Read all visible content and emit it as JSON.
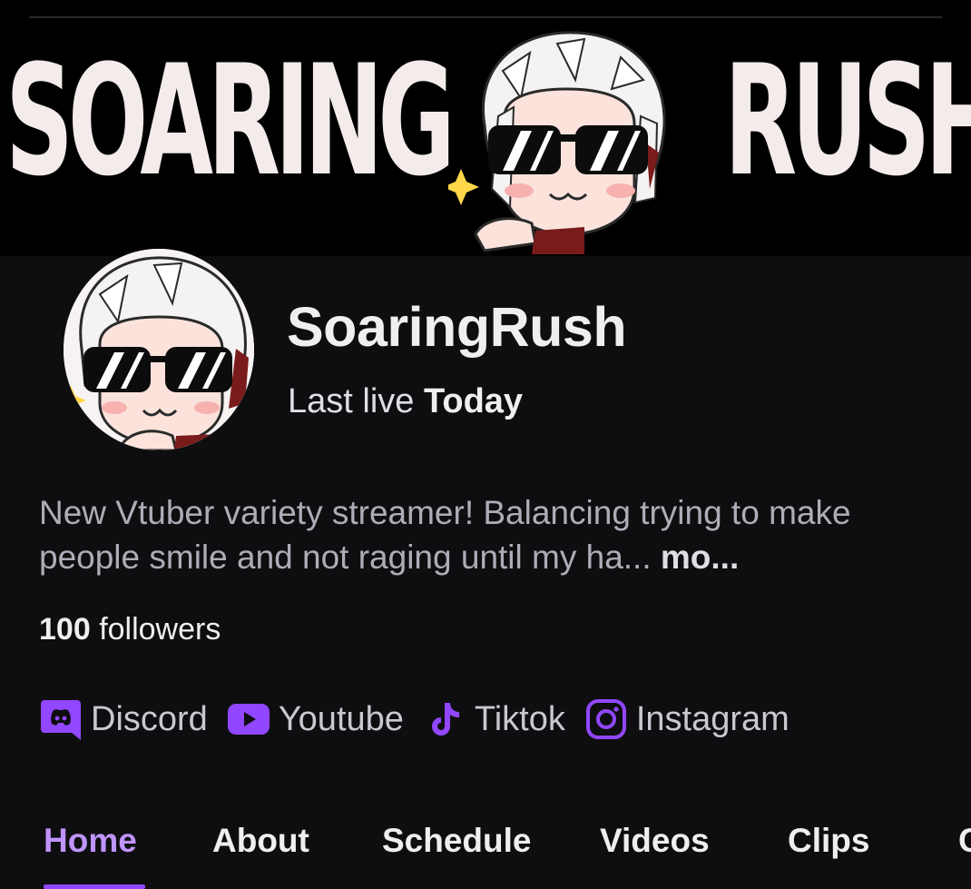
{
  "banner": {
    "left_word": "SOARING",
    "right_word": "RUSH"
  },
  "channel": {
    "name": "SoaringRush",
    "last_live_prefix": "Last live",
    "last_live_value": "Today",
    "bio_text": "New Vtuber variety streamer! Balancing trying to make people smile and not raging until my ha...",
    "bio_more": "mo...",
    "followers_count": "100",
    "followers_label": "followers"
  },
  "social_links": [
    {
      "label": "Discord",
      "icon": "discord-icon"
    },
    {
      "label": "Youtube",
      "icon": "youtube-icon"
    },
    {
      "label": "Tiktok",
      "icon": "tiktok-icon"
    },
    {
      "label": "Instagram",
      "icon": "instagram-icon"
    }
  ],
  "tabs": [
    {
      "label": "Home",
      "active": true
    },
    {
      "label": "About",
      "active": false
    },
    {
      "label": "Schedule",
      "active": false
    },
    {
      "label": "Videos",
      "active": false
    },
    {
      "label": "Clips",
      "active": false
    },
    {
      "label": "C",
      "active": false
    }
  ],
  "colors": {
    "background": "#0e0e10",
    "accent": "#9147ff",
    "accent_text": "#bf94ff",
    "text": "#efeff1",
    "muted_text": "#adadb8"
  }
}
